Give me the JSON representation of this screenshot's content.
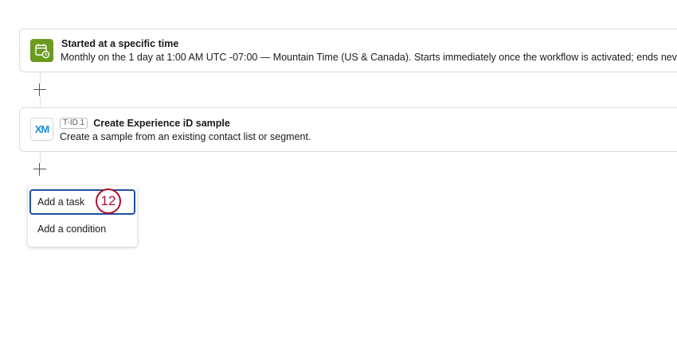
{
  "trigger": {
    "icon": "calendar-clock-icon",
    "icon_color": "#6c9a1f",
    "title": "Started at a specific time",
    "description": "Monthly on the 1 day at 1:00 AM UTC -07:00 — Mountain Time (US & Canada). Starts immediately once the workflow is activated; ends never"
  },
  "task": {
    "icon": "XM",
    "tag": "T-ID 1",
    "title": "Create Experience iD sample",
    "description": "Create a sample from an existing contact list or segment."
  },
  "menu": {
    "items": [
      {
        "label": "Add a task"
      },
      {
        "label": "Add a condition"
      }
    ]
  },
  "step_badge": {
    "label": "12",
    "color": "#b0102f"
  }
}
